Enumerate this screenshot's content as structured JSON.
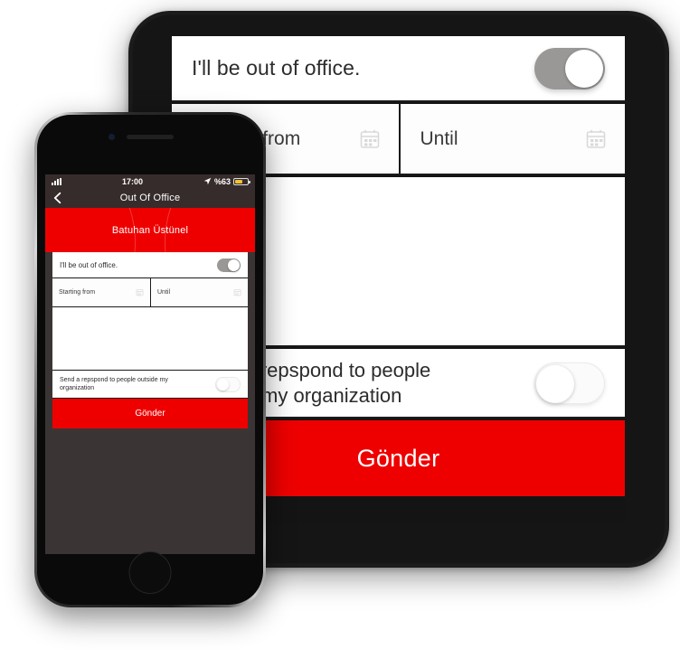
{
  "tablet": {
    "out_of_office": {
      "label": "I'll be out of office.",
      "toggle_state": "on",
      "toggle_name": "out-of-office-toggle"
    },
    "dates": [
      {
        "placeholder": "Starting from",
        "icon": "calendar-icon"
      },
      {
        "placeholder": "Until",
        "icon": "calendar-icon"
      }
    ],
    "message": {
      "value": "",
      "placeholder": ""
    },
    "outside_org": {
      "label": "Send a repspond to people outside my organization",
      "toggle_state": "off",
      "toggle_name": "outside-organization-toggle"
    },
    "submit_label": "Gönder",
    "accent_color": "#ee0000"
  },
  "phone": {
    "status_bar": {
      "signal": "signal-bars-icon",
      "time": "17:00",
      "location": "location-arrow-icon",
      "battery_text": "%63",
      "battery_icon": "battery-icon"
    },
    "nav": {
      "back_icon": "chevron-left-icon",
      "title": "Out Of Office"
    },
    "header": {
      "user_name": "Batuhan Üstünel",
      "background": "#ee0000"
    },
    "out_of_office": {
      "label": "I'll be out of office.",
      "toggle_state": "on"
    },
    "dates": [
      {
        "placeholder": "Starting from",
        "icon": "calendar-icon"
      },
      {
        "placeholder": "Until",
        "icon": "calendar-icon"
      }
    ],
    "message": {
      "value": ""
    },
    "outside_org": {
      "label": "Send a repspond to people outside my organization",
      "toggle_state": "off"
    },
    "submit_label": "Gönder"
  }
}
